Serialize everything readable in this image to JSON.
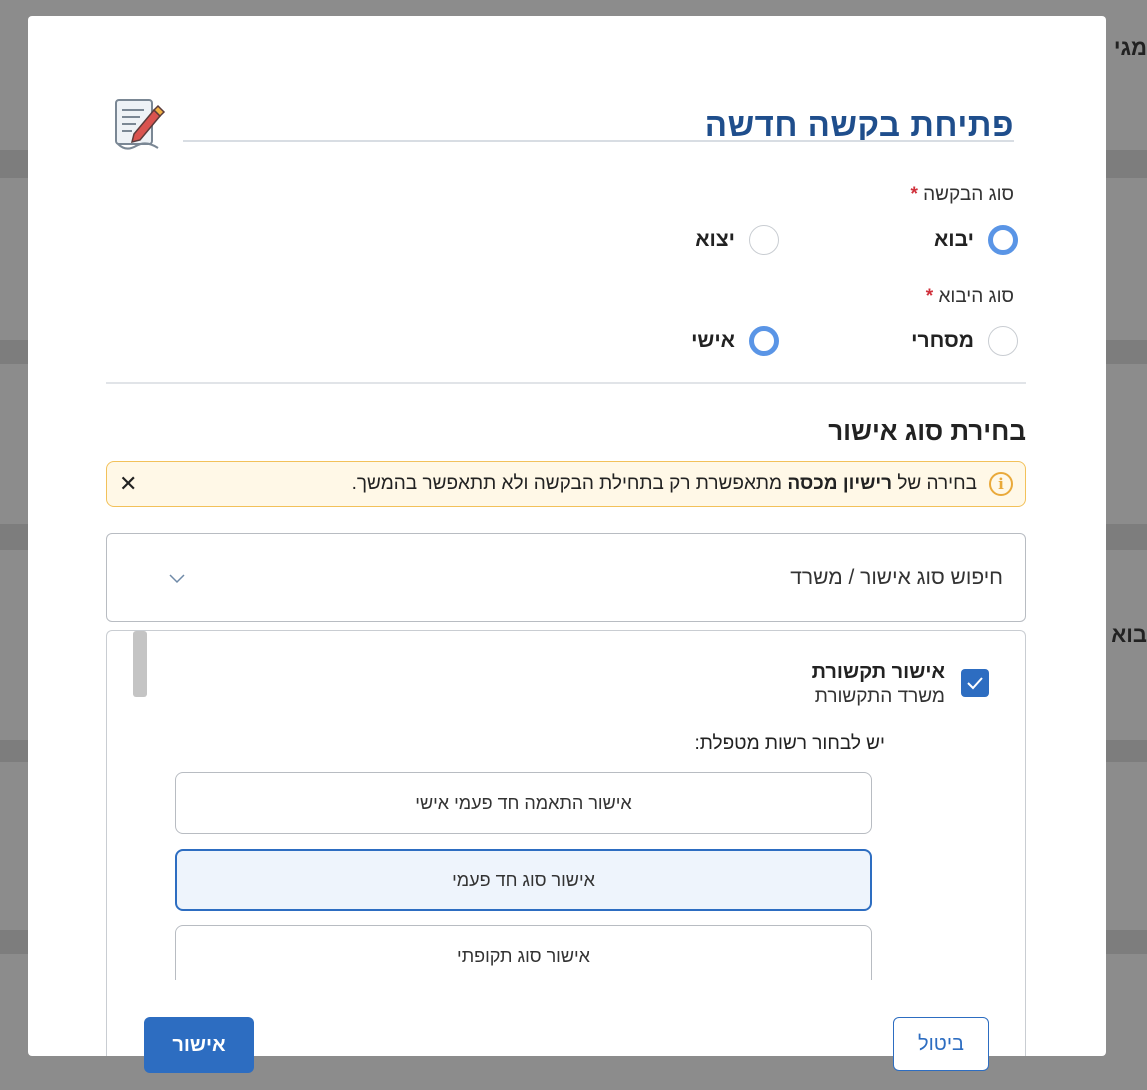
{
  "background": {
    "text_top": "מגי",
    "text_middle": "בוא"
  },
  "modal": {
    "title": "פתיחת בקשה חדשה",
    "request_type": {
      "label": "סוג הבקשה",
      "required_mark": "*",
      "options": [
        {
          "label": "יבוא",
          "selected": true
        },
        {
          "label": "יצוא",
          "selected": false
        }
      ]
    },
    "import_type": {
      "label": "סוג היבוא",
      "required_mark": "*",
      "options": [
        {
          "label": "מסחרי",
          "selected": false
        },
        {
          "label": "אישי",
          "selected": true
        }
      ]
    },
    "approval_section": {
      "title": "בחירת סוג אישור",
      "warning": {
        "prefix": "בחירה של",
        "bold": "רישיון מכסה",
        "suffix": "מתאפשרת רק בתחילת הבקשה ולא תתאפשר בהמשך."
      },
      "search_placeholder": "חיפוש סוג אישור / משרד",
      "selected_item": {
        "name": "אישור תקשורת",
        "office": "משרד התקשורת",
        "checked": true
      },
      "authority_label": "יש לבחור רשות מטפלת:",
      "authority_options": [
        {
          "label": "אישור התאמה חד פעמי אישי",
          "active": false
        },
        {
          "label": "אישור סוג חד פעמי",
          "active": true
        },
        {
          "label": "אישור סוג תקופתי",
          "active": false
        }
      ]
    },
    "footer": {
      "cancel_label": "ביטול",
      "confirm_label": "אישור"
    }
  },
  "colors": {
    "primary": "#2d6dc1",
    "title": "#1f4e8c",
    "radio_selected": "#5a95e6",
    "warning_border": "#f2c15a",
    "required": "#d0303b"
  }
}
